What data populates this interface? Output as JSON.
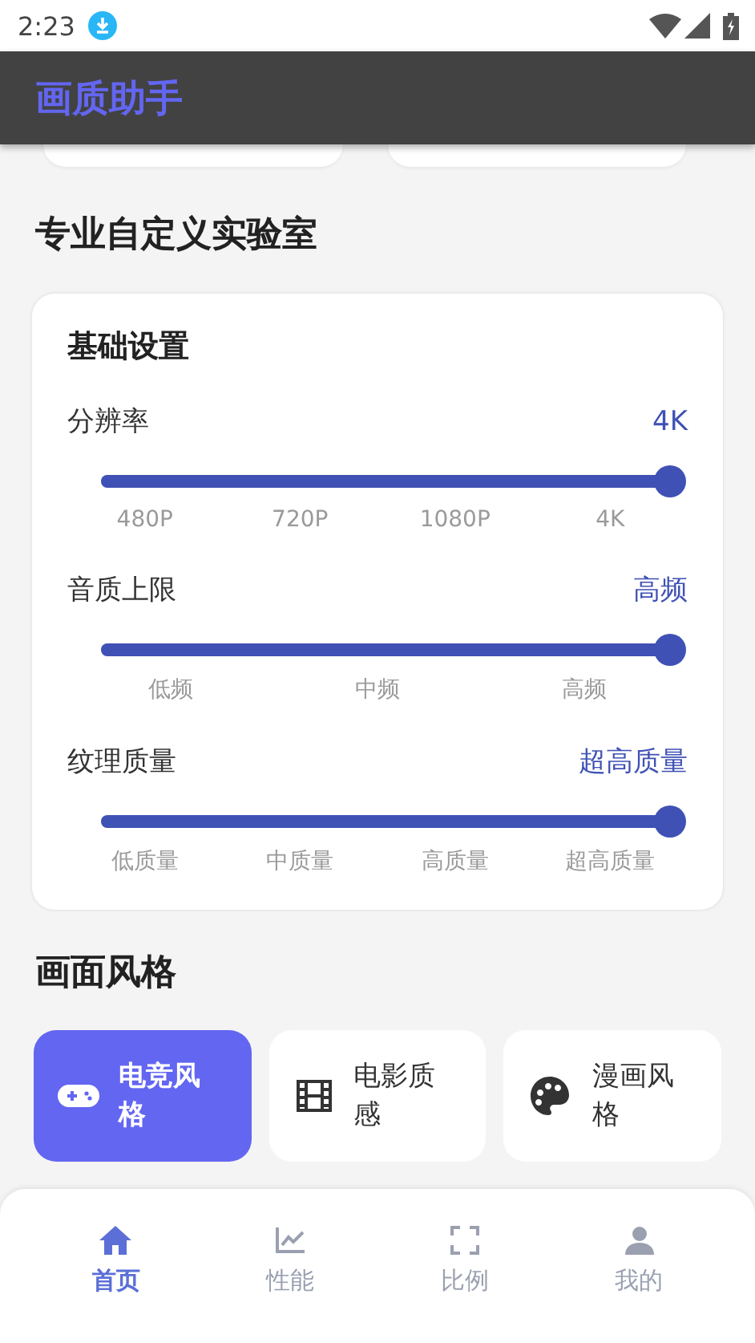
{
  "status_bar": {
    "time": "2:23"
  },
  "app_bar": {
    "title": "画质助手"
  },
  "section_title": "专业自定义实验室",
  "settings_card": {
    "title": "基础设置",
    "sliders": [
      {
        "label": "分辨率",
        "value": "4K",
        "level": 1,
        "ticks": [
          "480P",
          "720P",
          "1080P",
          "4K"
        ]
      },
      {
        "label": "音质上限",
        "value": "高频",
        "level": 1,
        "ticks": [
          "低频",
          "中频",
          "高频"
        ]
      },
      {
        "label": "纹理质量",
        "value": "超高质量",
        "level": 1,
        "ticks": [
          "低质量",
          "中质量",
          "高质量",
          "超高质量"
        ]
      }
    ]
  },
  "style_title": "画面风格",
  "styles": [
    {
      "kind": "gamepad",
      "label": "电竞风格",
      "selected": true
    },
    {
      "kind": "film",
      "label": "电影质感",
      "selected": false
    },
    {
      "kind": "palette",
      "label": "漫画风格",
      "selected": false
    }
  ],
  "bottom_nav": [
    {
      "kind": "home",
      "label": "首页",
      "selected": true
    },
    {
      "kind": "chart",
      "label": "性能",
      "selected": false
    },
    {
      "kind": "frame",
      "label": "比例",
      "selected": false
    },
    {
      "kind": "person",
      "label": "我的",
      "selected": false
    }
  ]
}
